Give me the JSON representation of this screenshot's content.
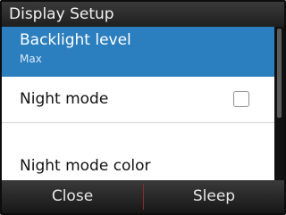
{
  "dialog": {
    "title": "Display Setup"
  },
  "menu": {
    "items": [
      {
        "label": "Backlight level",
        "value": "Max"
      },
      {
        "label": "Night mode",
        "checked": false
      },
      {
        "label": "Night mode color"
      }
    ]
  },
  "softkeys": {
    "left": "Close",
    "right": "Sleep"
  },
  "colors": {
    "selection": "#2c7fbf",
    "divider": "#8a2b2b"
  }
}
